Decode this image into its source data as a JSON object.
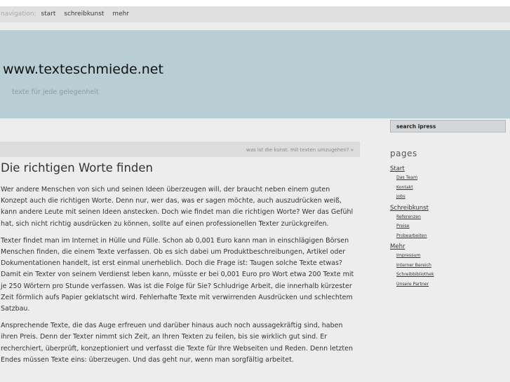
{
  "nav": {
    "label": "navigation:",
    "items": [
      "start",
      "schreibkunst",
      "mehr"
    ]
  },
  "header": {
    "title": "www.texteschmiede.net",
    "tagline": "texte für jede gelegenheit"
  },
  "search": {
    "text": "search ipress"
  },
  "infobar": {
    "text": "was ist die kunst. mit texten umzugehen? »"
  },
  "article": {
    "title": "Die richtigen Worte finden",
    "paragraphs": [
      "Wer andere Menschen von sich und seinen Ideen überzeugen will, der braucht neben einem guten Konzept auch die richtigen Worte. Denn nur, wer das, was er sagen möchte, auch auszudrücken weiß, kann andere Leute mit seinen Ideen anstecken. Doch wie findet man die richtigen Worte? Wer das Gefühl hat, sich nicht richtig ausdrücken zu können, sollte auf einen professionellen Texter zurückgreifen.",
      "Texter findet man im Internet in Hülle und Fülle. Schon ab 0,001 Euro kann man in einschlägigen Börsen Menschen finden, die einem Texte verfassen. Ob es sich dabei um Produktbeschreibungen, Artikel oder Dokumentationen handelt, ist erst einmal unerheblich. Doch die Frage ist: Taugen solche Texte etwas? Damit ein Texter von seinem Verdienst leben kann, müsste er bei 0,001 Euro pro Wort etwa 200 Texte mit je 250 Wörtern pro Stunde verfassen. Was ist die Folge für Sie? Schludrige Arbeit, die innerhalb kürzester Zeit förmlich aufs Papier geklatscht wird. Fehlerhafte Texte mit verwirrenden Ausdrücken und schlechtem Satzbau.",
      "Ansprechende Texte, die das Auge erfreuen und darüber hinaus auch noch aussagekräftig sind, haben ihren Preis. Denn der Texter nimmt sich Zeit, an Ihren Texten zu feilen, bis sie wirklich gut sind. Er recherchiert, überprüft, konzeptioniert und verfasst die Texte für Ihre Webseiten und Reden. Denn letzten Endes müssen Texte eins: überzeugen. Und das geht nur, wenn man sorgfältig arbeitet."
    ]
  },
  "sidebar": {
    "title": "pages",
    "groups": [
      {
        "label": "Start",
        "items": [
          "Das Team",
          "Kontakt",
          "Jobs"
        ]
      },
      {
        "label": "Schreibkunst",
        "items": [
          "Referenzen",
          "Preise",
          "Probearbeiten"
        ]
      },
      {
        "label": "Mehr",
        "items": [
          "Impressum",
          "Interner Bereich",
          "Schreibbibliothek",
          "Unsere Partner"
        ]
      }
    ]
  }
}
